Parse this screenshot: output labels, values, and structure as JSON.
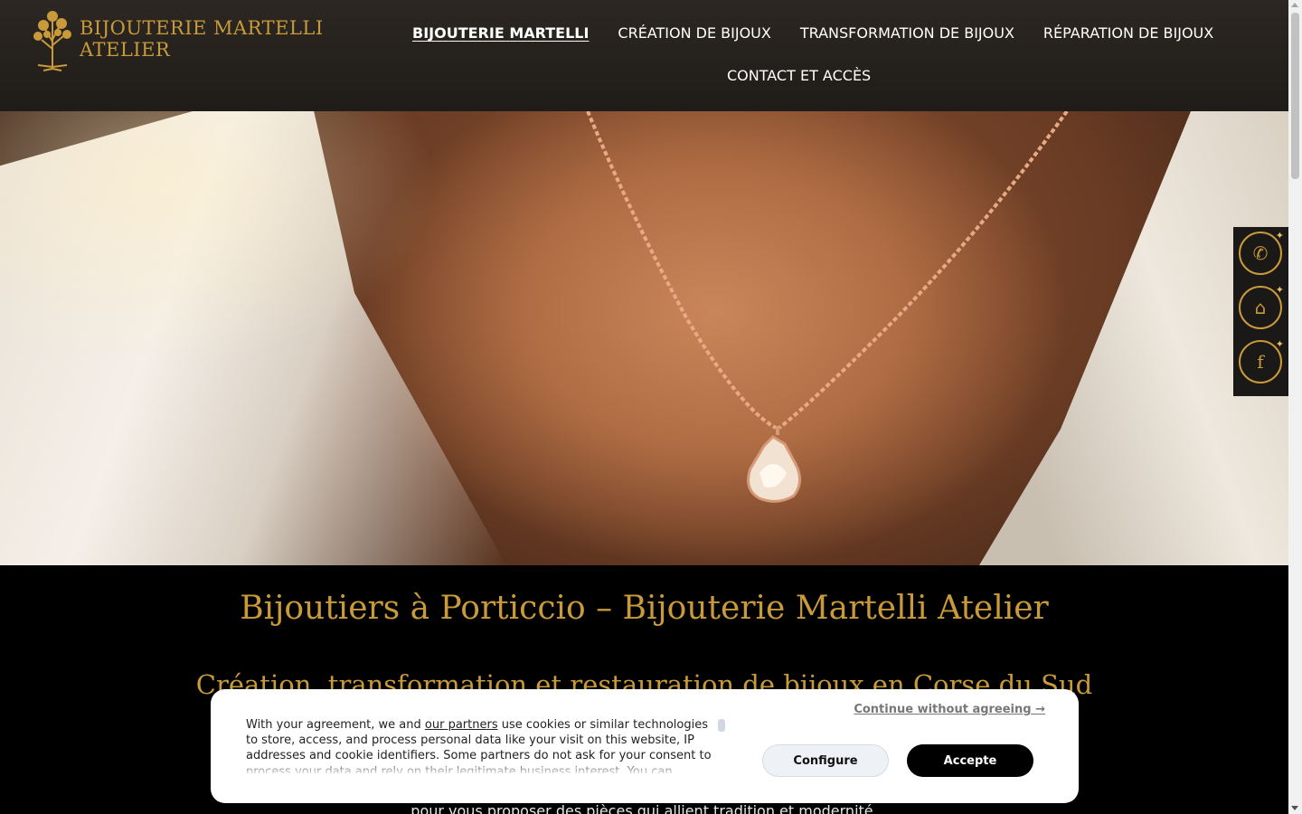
{
  "header": {
    "logo_line1": "BIJOUTERIE MARTELLI",
    "logo_line2": "ATELIER",
    "nav": [
      {
        "label": "BIJOUTERIE MARTELLI",
        "active": true
      },
      {
        "label": "CRÉATION DE BIJOUX"
      },
      {
        "label": "TRANSFORMATION DE BIJOUX"
      },
      {
        "label": "RÉPARATION DE BIJOUX"
      },
      {
        "label": "CONTACT ET ACCÈS"
      }
    ]
  },
  "side_buttons": [
    {
      "icon": "phone-icon"
    },
    {
      "icon": "store-icon"
    },
    {
      "icon": "facebook-icon"
    }
  ],
  "main": {
    "title": "Bijoutiers à Porticcio – Bijouterie Martelli Atelier",
    "subtitle": "Création, transformation et restauration de bijoux en Corse du Sud",
    "body_line": "pour vous proposer des pièces qui allient tradition et modernité."
  },
  "cookie": {
    "text_before_link": "With your agreement, we and ",
    "link": "our partners",
    "text_after_link": " use cookies or similar technologies to store, access, and process personal data like your visit on this website, IP addresses and cookie identifiers. Some partners do not ask for your consent to process your data and rely on their legitimate business interest. You can",
    "continue": "Continue without agreeing →",
    "configure": "Configure",
    "accept": "Accepte"
  },
  "colors": {
    "gold": "#c99a3a",
    "header_bg": "#2c2722",
    "content_bg": "#000000"
  }
}
